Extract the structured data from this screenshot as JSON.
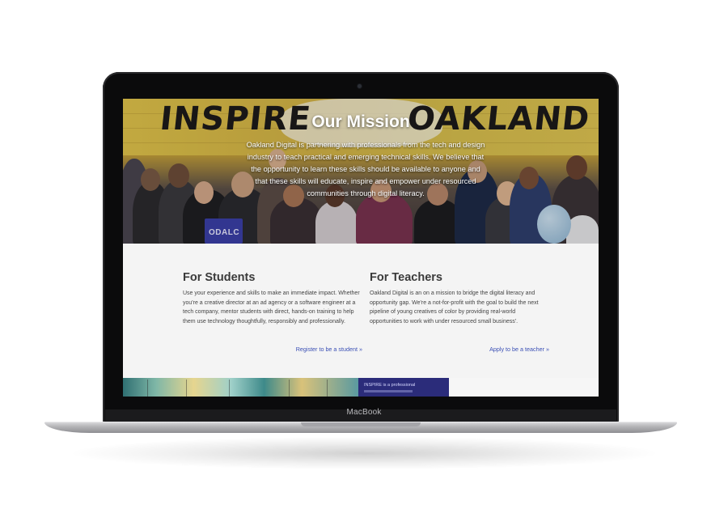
{
  "device": {
    "brand_label": "MacBook"
  },
  "hero": {
    "mural_left": "INSPIRE",
    "mural_right": "OAKLAND",
    "title": "Our Mission",
    "text": "Oakland Digital is partnering with professionals from the tech and design industry to teach practical and emerging technical skills. We believe that the opportunity to learn these skills should be available to anyone and that these skills will educate, inspire and empower under resourced communities through digital literacy.",
    "sign_text": "ODALC"
  },
  "students": {
    "heading": "For Students",
    "body": "Use your experience and skills to make an immediate impact. Whether you're a creative director at an ad agency or a software engineer at a tech company, mentor students with direct, hands-on training to help them use technology thoughtfully, responsibly and professionally.",
    "link": "Register to be a student »"
  },
  "teachers": {
    "heading": "For Teachers",
    "body": "Oakland Digital is an on a mission to bridge the digital literacy and opportunity gap. We're a not-for-profit with the goal to build the next pipeline of young creatives of color by providing real-world opportunities to work with under resourced small business'.",
    "link": "Apply to be a teacher »"
  },
  "strip": {
    "navy_text": "INSPIRE is a professional"
  },
  "colors": {
    "link": "#3a4fb5",
    "heading": "#3a3a3a",
    "content_bg": "#f4f4f4",
    "navy_panel": "#2b2c7a"
  }
}
